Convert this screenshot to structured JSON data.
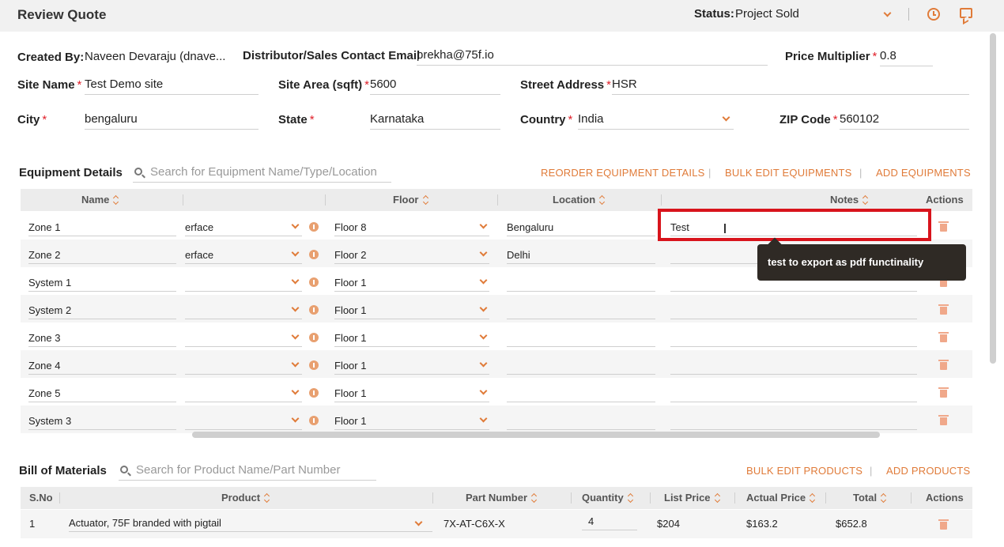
{
  "header": {
    "title": "Review Quote",
    "status_label": "Status:",
    "status_value": "Project Sold"
  },
  "form": {
    "created_by_label": "Created By:",
    "created_by": "Naveen Devaraju (dnave...",
    "email_label": "Distributor/Sales Contact Email",
    "email": "prekha@75f.io",
    "multiplier_label": "Price Multiplier",
    "multiplier": "0.8",
    "site_name_label": "Site Name",
    "site_name": "Test Demo site",
    "site_area_label": "Site Area (sqft)",
    "site_area": "5600",
    "street_label": "Street Address",
    "street": "HSR",
    "city_label": "City",
    "city": "bengaluru",
    "state_label": "State",
    "state": "Karnataka",
    "country_label": "Country",
    "country": "India",
    "zip_label": "ZIP Code",
    "zip": "560102",
    "required_mark": "*"
  },
  "equipment": {
    "title": "Equipment Details",
    "search_placeholder": "Search for Equipment Name/Type/Location",
    "reorder_label": "REORDER EQUIPMENT DETAILS",
    "bulk_edit_label": "BULK EDIT EQUIPMENTS",
    "add_label": "ADD EQUIPMENTS",
    "separator": "|",
    "columns": {
      "name": "Name",
      "floor": "Floor",
      "location": "Location",
      "notes": "Notes",
      "actions": "Actions"
    },
    "rows": [
      {
        "name": "Zone 1",
        "type": "erface",
        "floor": "Floor 8",
        "location": "Bengaluru",
        "notes": "Test"
      },
      {
        "name": "Zone 2",
        "type": "erface",
        "floor": "Floor 2",
        "location": "Delhi",
        "notes": ""
      },
      {
        "name": "System 1",
        "type": "",
        "floor": "Floor 1",
        "location": "",
        "notes": ""
      },
      {
        "name": "System 2",
        "type": "",
        "floor": "Floor 1",
        "location": "",
        "notes": ""
      },
      {
        "name": "Zone 3",
        "type": "",
        "floor": "Floor 1",
        "location": "",
        "notes": ""
      },
      {
        "name": "Zone 4",
        "type": "",
        "floor": "Floor 1",
        "location": "",
        "notes": ""
      },
      {
        "name": "Zone 5",
        "type": "",
        "floor": "Floor 1",
        "location": "",
        "notes": ""
      },
      {
        "name": "System 3",
        "type": "",
        "floor": "Floor 1",
        "location": "",
        "notes": ""
      }
    ],
    "tooltip": "test to export as pdf functinality"
  },
  "bom": {
    "title": "Bill of Materials",
    "search_placeholder": "Search for Product Name/Part Number",
    "bulk_edit_label": "BULK EDIT PRODUCTS",
    "add_label": "ADD PRODUCTS",
    "separator": "|",
    "columns": {
      "sno": "S.No",
      "product": "Product",
      "part": "Part Number",
      "qty": "Quantity",
      "list": "List Price",
      "actual": "Actual Price",
      "total": "Total",
      "actions": "Actions"
    },
    "rows": [
      {
        "sno": "1",
        "product": "Actuator, 75F branded with pigtail",
        "part": "7X-AT-C6X-X",
        "qty": "4",
        "list": "$204",
        "actual": "$163.2",
        "total": "$652.8"
      }
    ]
  },
  "colors": {
    "accent": "#e07b39",
    "required": "#e0202a",
    "highlight": "#d8141c"
  }
}
